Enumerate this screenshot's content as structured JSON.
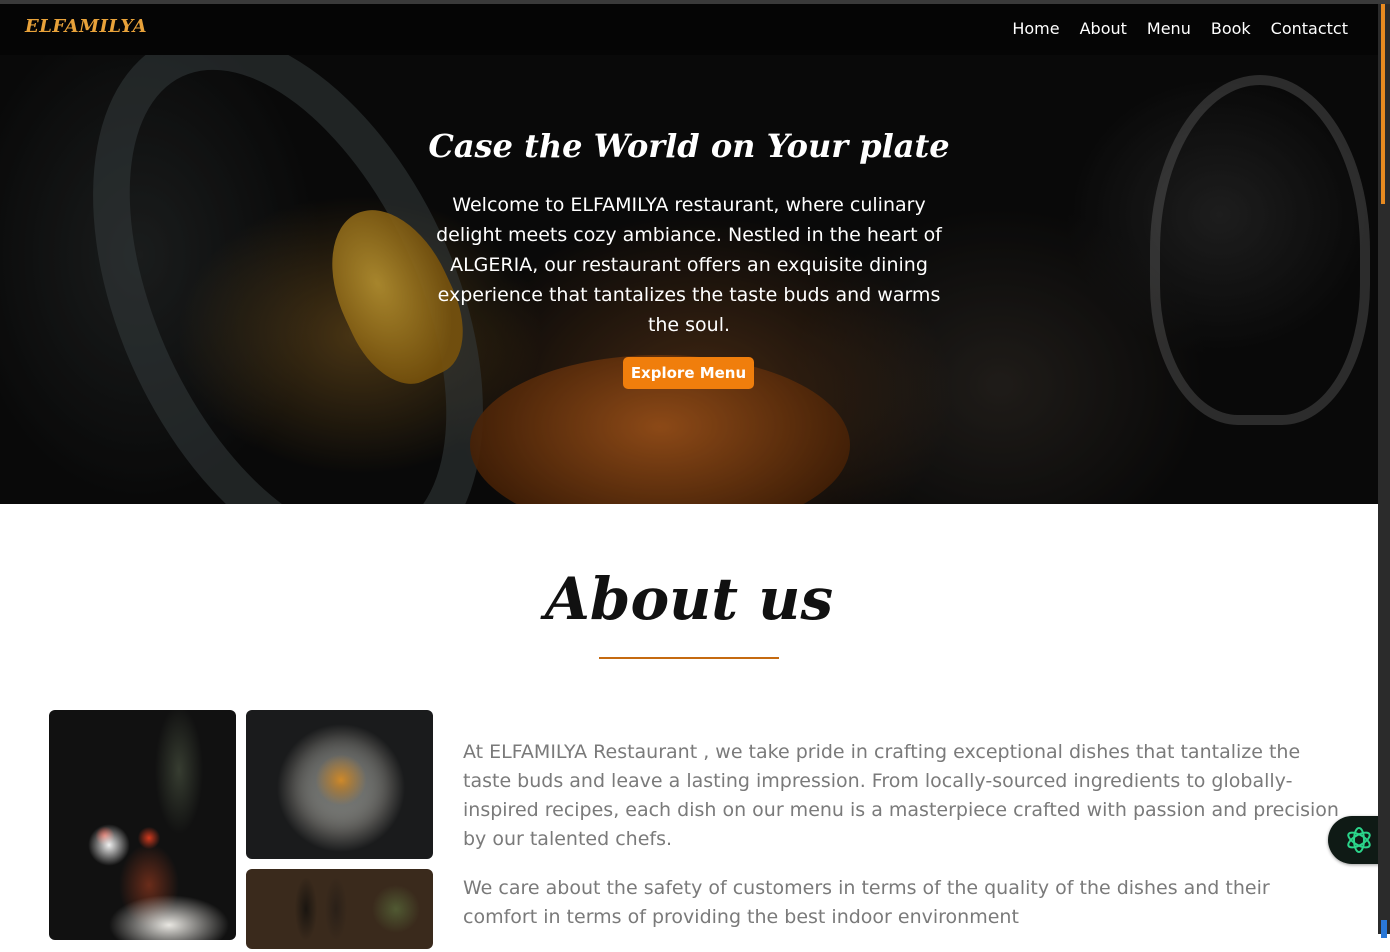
{
  "brand": "ELFAMILYA",
  "nav": {
    "items": [
      "Home",
      "About",
      "Menu",
      "Book",
      "Contactct"
    ]
  },
  "hero": {
    "title": "Case the World on Your plate",
    "text": "Welcome to ELFAMILYA restaurant, where culinary delight meets cozy ambiance. Nestled in the heart of ALGERIA, our restaurant offers an exquisite dining experience that tantalizes the taste buds and warms the soul.",
    "button": "Explore Menu"
  },
  "about": {
    "title": "About us",
    "paragraphs": [
      "At ELFAMILYA Restaurant , we take pride in crafting exceptional dishes that tantalize the taste buds and leave a lasting impression. From locally-sourced ingredients to globally-inspired recipes, each dish on our menu is a masterpiece crafted with passion and precision by our talented chefs.",
      "We care about the safety of customers in terms of the quality of the dishes and their comfort in terms of providing the best indoor environment"
    ]
  },
  "colors": {
    "accent": "#f07e0c",
    "brand": "#e8a23a",
    "navbar": "#050505",
    "divider": "#c56a10"
  },
  "icons": {
    "fab": "assistant-icon"
  }
}
